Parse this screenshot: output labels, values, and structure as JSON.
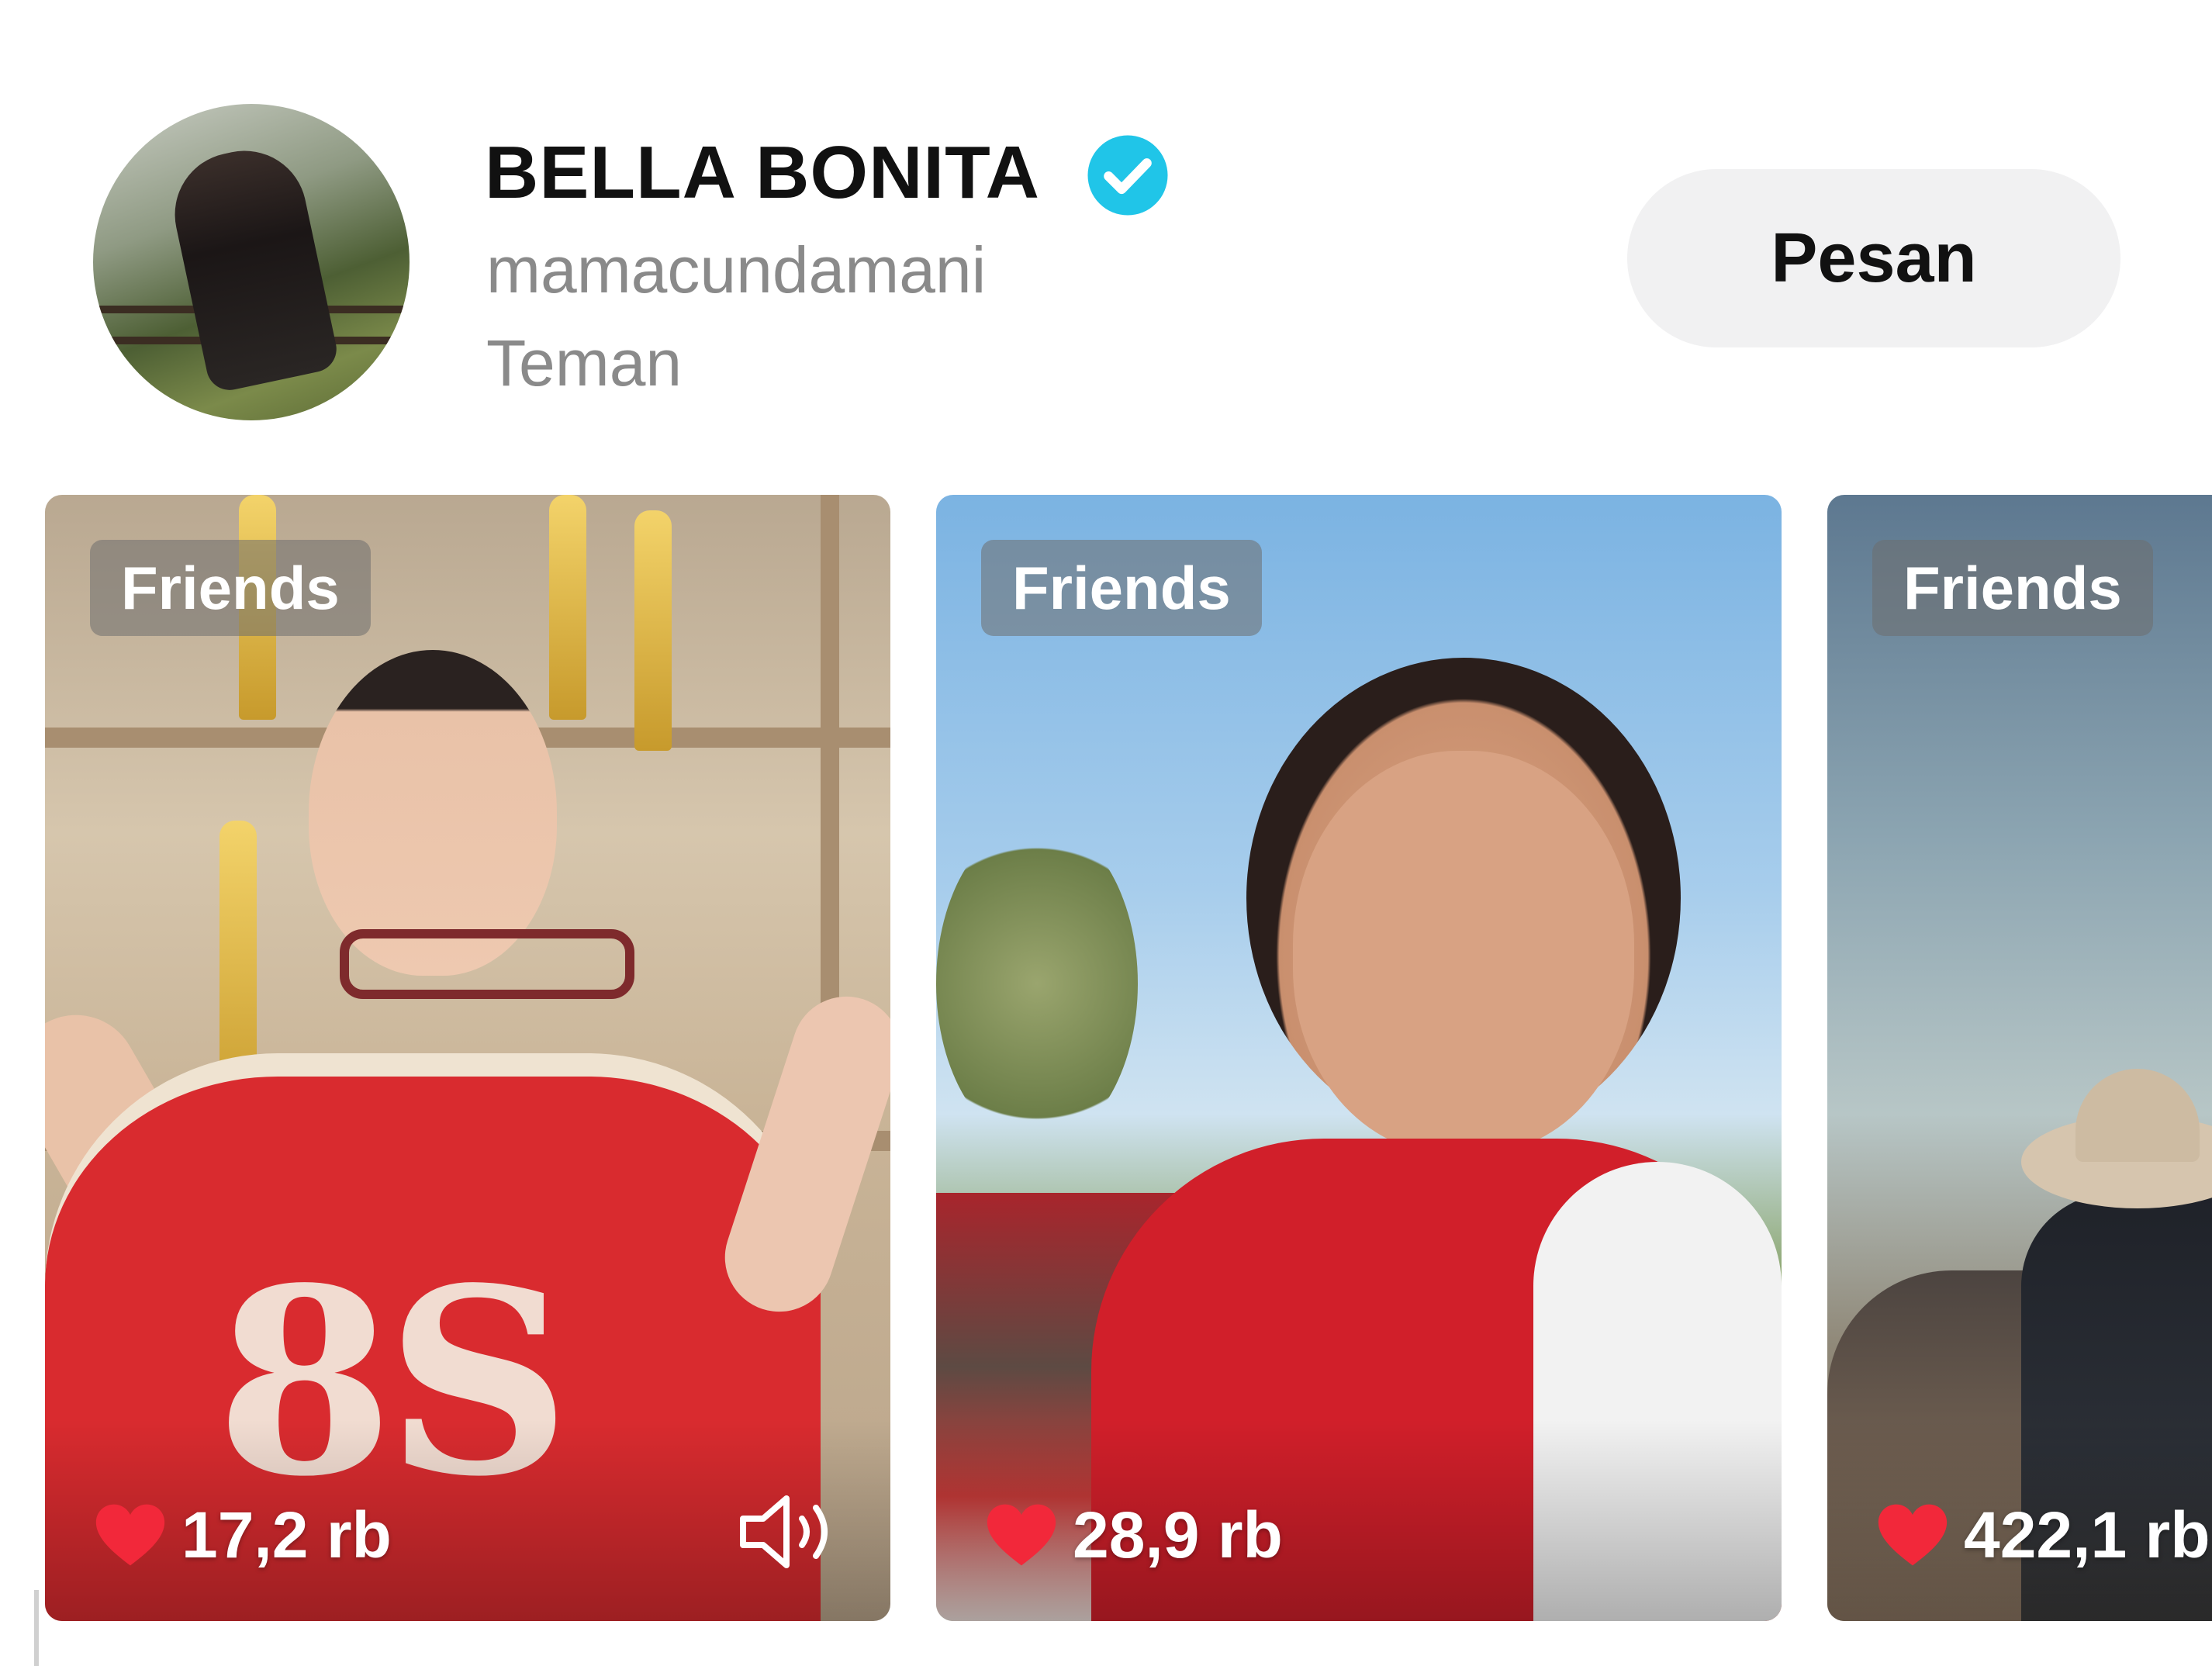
{
  "profile": {
    "display_name": "BELLA BONITA",
    "username": "mamacundamani",
    "relation": "Teman",
    "verified": true,
    "message_button_label": "Pesan"
  },
  "icons": {
    "verified": "verified-check-icon",
    "like": "heart-icon",
    "sound": "speaker-icon"
  },
  "colors": {
    "verified_badge": "#20c5e8",
    "heart": "#f2283a",
    "button_bg": "#f1f1f2"
  },
  "videos": [
    {
      "tag": "Friends",
      "likes": "17,2 rb",
      "has_sound_icon": true
    },
    {
      "tag": "Friends",
      "likes": "28,9 rb",
      "has_sound_icon": false
    },
    {
      "tag": "Friends",
      "likes": "422,1 rb",
      "has_sound_icon": false
    }
  ]
}
